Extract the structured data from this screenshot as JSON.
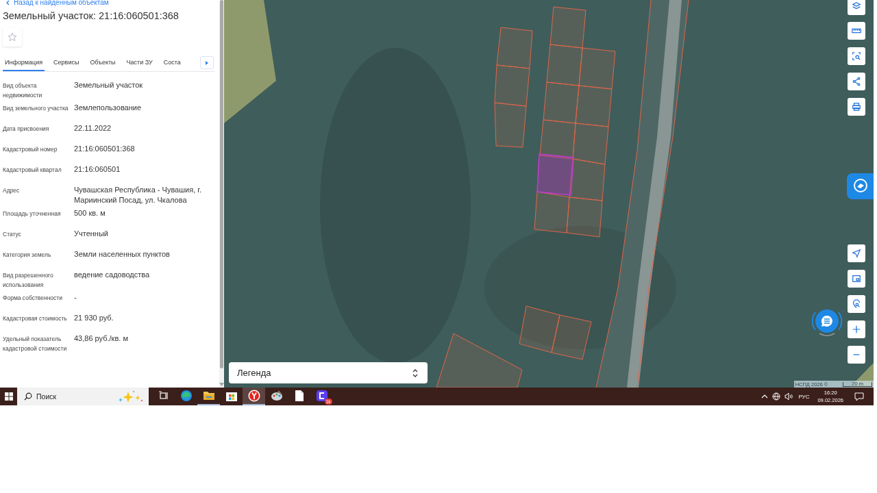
{
  "panel": {
    "back_link": "Назад к найденным объектам",
    "title": "Земельный участок: 21:16:060501:368",
    "favorite": false,
    "tabs": [
      {
        "label": "Информация",
        "selected": true
      },
      {
        "label": "Сервисы",
        "selected": false
      },
      {
        "label": "Объекты",
        "selected": false
      },
      {
        "label": "Части ЗУ",
        "selected": false
      },
      {
        "label": "Соста",
        "selected": false
      }
    ],
    "fields": [
      {
        "label": "Вид объекта недвижимости",
        "value": "Земельный участок"
      },
      {
        "label": "Вид земельного участка",
        "value": "Землепользование"
      },
      {
        "label": "Дата присвоения",
        "value": "22.11.2022"
      },
      {
        "label": "Кадастровый номер",
        "value": "21:16:060501:368"
      },
      {
        "label": "Кадастровый квартал",
        "value": "21:16:060501"
      },
      {
        "label": "Адрес",
        "value": "Чувашская Республика - Чувашия, г. Мариинский Посад, ул. Чкалова"
      },
      {
        "label": "Площадь уточненная",
        "value": "500 кв. м"
      },
      {
        "label": "Статус",
        "value": "Учтенный"
      },
      {
        "label": "Категория земель",
        "value": "Земли населенных пунктов"
      },
      {
        "label": "Вид разрешенного использования",
        "value": "ведение садоводства"
      },
      {
        "label": "Форма собственности",
        "value": "-"
      },
      {
        "label": "Кадастровая стоимость",
        "value": "21 930 руб."
      },
      {
        "label": "Удельный показатель кадастровой стоимости",
        "value": "43,86 руб./кв. м"
      }
    ]
  },
  "map": {
    "legend": "Легенда",
    "attribution": "НСПД 2026 ©",
    "scale": "20 m"
  },
  "taskbar": {
    "search_placeholder": "Поиск",
    "apps": [
      {
        "kind": "taskview",
        "running": false,
        "selected": false
      },
      {
        "kind": "edge",
        "running": false,
        "selected": false
      },
      {
        "kind": "folder",
        "running": true,
        "selected": false
      },
      {
        "kind": "store",
        "running": false,
        "selected": false
      },
      {
        "kind": "yandex",
        "running": true,
        "selected": true
      },
      {
        "kind": "palette",
        "running": false,
        "selected": false
      },
      {
        "kind": "document",
        "running": false,
        "selected": false
      },
      {
        "kind": "messenger",
        "running": false,
        "selected": false,
        "badge": "1k"
      }
    ],
    "tray": {
      "language": "РУС",
      "time": "16:20",
      "date": "09.02.2026"
    }
  }
}
